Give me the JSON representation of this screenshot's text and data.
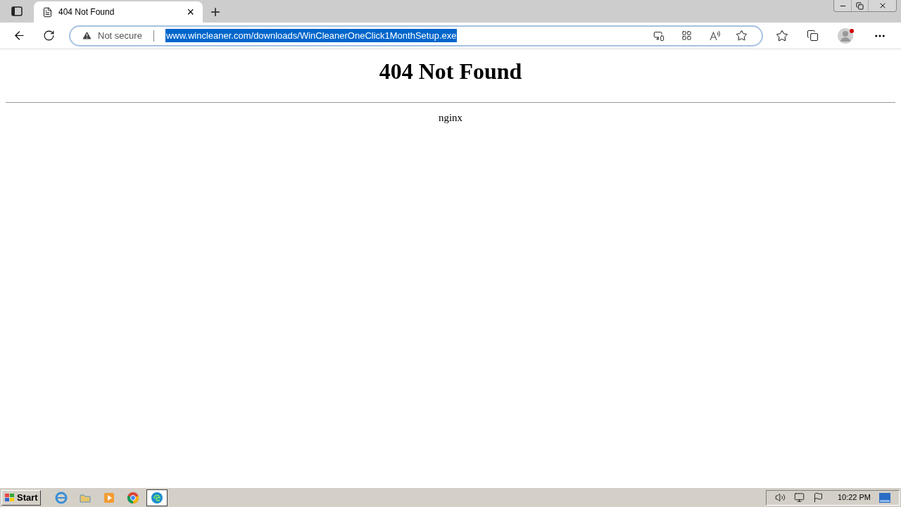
{
  "browser": {
    "tab": {
      "title": "404 Not Found",
      "close": "×"
    },
    "new_tab": "+",
    "address": {
      "security": "Not secure",
      "url": "www.wincleaner.com/downloads/WinCleanerOneClick1MonthSetup.exe",
      "selected": true
    }
  },
  "page": {
    "heading": "404 Not Found",
    "server": "nginx"
  },
  "taskbar": {
    "start": "Start",
    "apps": [
      {
        "kind": "ie",
        "selected": false
      },
      {
        "kind": "folder",
        "selected": false
      },
      {
        "kind": "media",
        "selected": false
      },
      {
        "kind": "chrome",
        "selected": false
      },
      {
        "kind": "edge",
        "selected": true
      }
    ],
    "clock": "10:22 PM"
  }
}
